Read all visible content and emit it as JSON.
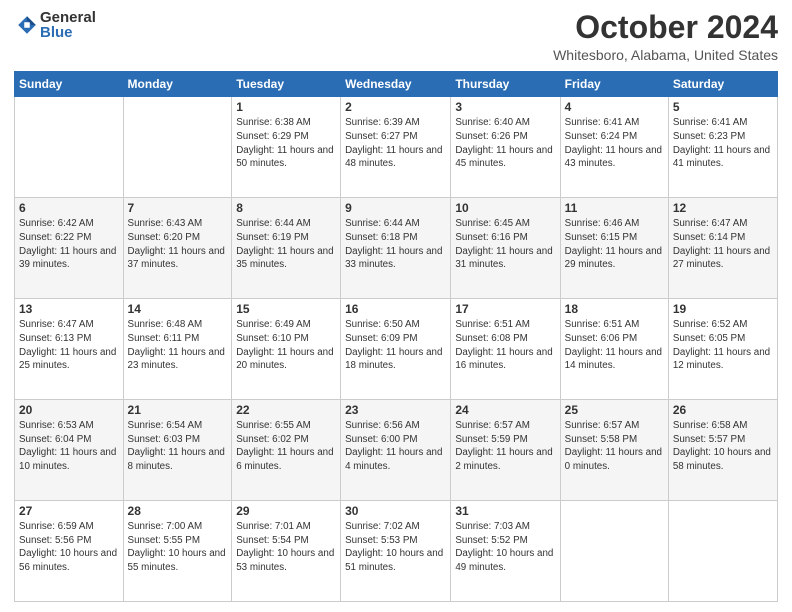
{
  "logo": {
    "general": "General",
    "blue": "Blue"
  },
  "title": {
    "month": "October 2024",
    "location": "Whitesboro, Alabama, United States"
  },
  "days_header": [
    "Sunday",
    "Monday",
    "Tuesday",
    "Wednesday",
    "Thursday",
    "Friday",
    "Saturday"
  ],
  "weeks": [
    [
      {
        "day": "",
        "info": ""
      },
      {
        "day": "",
        "info": ""
      },
      {
        "day": "1",
        "info": "Sunrise: 6:38 AM\nSunset: 6:29 PM\nDaylight: 11 hours and 50 minutes."
      },
      {
        "day": "2",
        "info": "Sunrise: 6:39 AM\nSunset: 6:27 PM\nDaylight: 11 hours and 48 minutes."
      },
      {
        "day": "3",
        "info": "Sunrise: 6:40 AM\nSunset: 6:26 PM\nDaylight: 11 hours and 45 minutes."
      },
      {
        "day": "4",
        "info": "Sunrise: 6:41 AM\nSunset: 6:24 PM\nDaylight: 11 hours and 43 minutes."
      },
      {
        "day": "5",
        "info": "Sunrise: 6:41 AM\nSunset: 6:23 PM\nDaylight: 11 hours and 41 minutes."
      }
    ],
    [
      {
        "day": "6",
        "info": "Sunrise: 6:42 AM\nSunset: 6:22 PM\nDaylight: 11 hours and 39 minutes."
      },
      {
        "day": "7",
        "info": "Sunrise: 6:43 AM\nSunset: 6:20 PM\nDaylight: 11 hours and 37 minutes."
      },
      {
        "day": "8",
        "info": "Sunrise: 6:44 AM\nSunset: 6:19 PM\nDaylight: 11 hours and 35 minutes."
      },
      {
        "day": "9",
        "info": "Sunrise: 6:44 AM\nSunset: 6:18 PM\nDaylight: 11 hours and 33 minutes."
      },
      {
        "day": "10",
        "info": "Sunrise: 6:45 AM\nSunset: 6:16 PM\nDaylight: 11 hours and 31 minutes."
      },
      {
        "day": "11",
        "info": "Sunrise: 6:46 AM\nSunset: 6:15 PM\nDaylight: 11 hours and 29 minutes."
      },
      {
        "day": "12",
        "info": "Sunrise: 6:47 AM\nSunset: 6:14 PM\nDaylight: 11 hours and 27 minutes."
      }
    ],
    [
      {
        "day": "13",
        "info": "Sunrise: 6:47 AM\nSunset: 6:13 PM\nDaylight: 11 hours and 25 minutes."
      },
      {
        "day": "14",
        "info": "Sunrise: 6:48 AM\nSunset: 6:11 PM\nDaylight: 11 hours and 23 minutes."
      },
      {
        "day": "15",
        "info": "Sunrise: 6:49 AM\nSunset: 6:10 PM\nDaylight: 11 hours and 20 minutes."
      },
      {
        "day": "16",
        "info": "Sunrise: 6:50 AM\nSunset: 6:09 PM\nDaylight: 11 hours and 18 minutes."
      },
      {
        "day": "17",
        "info": "Sunrise: 6:51 AM\nSunset: 6:08 PM\nDaylight: 11 hours and 16 minutes."
      },
      {
        "day": "18",
        "info": "Sunrise: 6:51 AM\nSunset: 6:06 PM\nDaylight: 11 hours and 14 minutes."
      },
      {
        "day": "19",
        "info": "Sunrise: 6:52 AM\nSunset: 6:05 PM\nDaylight: 11 hours and 12 minutes."
      }
    ],
    [
      {
        "day": "20",
        "info": "Sunrise: 6:53 AM\nSunset: 6:04 PM\nDaylight: 11 hours and 10 minutes."
      },
      {
        "day": "21",
        "info": "Sunrise: 6:54 AM\nSunset: 6:03 PM\nDaylight: 11 hours and 8 minutes."
      },
      {
        "day": "22",
        "info": "Sunrise: 6:55 AM\nSunset: 6:02 PM\nDaylight: 11 hours and 6 minutes."
      },
      {
        "day": "23",
        "info": "Sunrise: 6:56 AM\nSunset: 6:00 PM\nDaylight: 11 hours and 4 minutes."
      },
      {
        "day": "24",
        "info": "Sunrise: 6:57 AM\nSunset: 5:59 PM\nDaylight: 11 hours and 2 minutes."
      },
      {
        "day": "25",
        "info": "Sunrise: 6:57 AM\nSunset: 5:58 PM\nDaylight: 11 hours and 0 minutes."
      },
      {
        "day": "26",
        "info": "Sunrise: 6:58 AM\nSunset: 5:57 PM\nDaylight: 10 hours and 58 minutes."
      }
    ],
    [
      {
        "day": "27",
        "info": "Sunrise: 6:59 AM\nSunset: 5:56 PM\nDaylight: 10 hours and 56 minutes."
      },
      {
        "day": "28",
        "info": "Sunrise: 7:00 AM\nSunset: 5:55 PM\nDaylight: 10 hours and 55 minutes."
      },
      {
        "day": "29",
        "info": "Sunrise: 7:01 AM\nSunset: 5:54 PM\nDaylight: 10 hours and 53 minutes."
      },
      {
        "day": "30",
        "info": "Sunrise: 7:02 AM\nSunset: 5:53 PM\nDaylight: 10 hours and 51 minutes."
      },
      {
        "day": "31",
        "info": "Sunrise: 7:03 AM\nSunset: 5:52 PM\nDaylight: 10 hours and 49 minutes."
      },
      {
        "day": "",
        "info": ""
      },
      {
        "day": "",
        "info": ""
      }
    ]
  ]
}
